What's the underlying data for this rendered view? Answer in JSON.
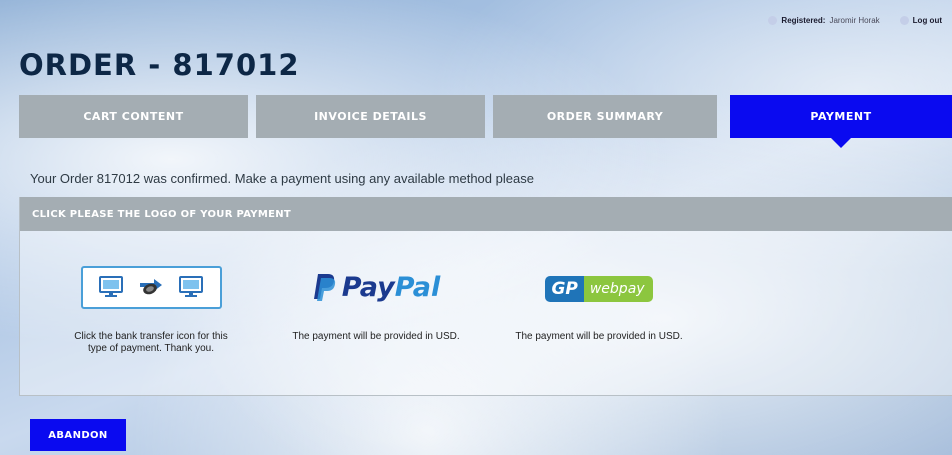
{
  "topbar": {
    "registered_label": "Registered:",
    "registered_name": "Jaromir Horak",
    "logout_label": "Log out"
  },
  "page": {
    "title": "ORDER - 817012"
  },
  "tabs": [
    {
      "label": "CART CONTENT",
      "active": false
    },
    {
      "label": "INVOICE DETAILS",
      "active": false
    },
    {
      "label": "ORDER SUMMARY",
      "active": false
    },
    {
      "label": "PAYMENT",
      "active": true
    }
  ],
  "confirmation": {
    "text": "Your Order 817012 was confirmed.  Make a payment using any available method please"
  },
  "payment_panel": {
    "header": "CLICK PLEASE THE LOGO OF YOUR PAYMENT",
    "methods": [
      {
        "icon": "bank-transfer-icon",
        "description": "Click the bank transfer icon for this type of payment. Thank you."
      },
      {
        "icon": "paypal-logo",
        "logo_text_1": "Pay",
        "logo_text_2": "Pal",
        "description": "The payment will be provided in USD."
      },
      {
        "icon": "gp-webpay-logo",
        "logo_text_1": "GP",
        "logo_text_2": "webpay",
        "description": "The payment will be provided in USD."
      }
    ]
  },
  "actions": {
    "abandon_label": "ABANDON"
  },
  "colors": {
    "accent": "#0a0af0",
    "tab_inactive": "#a4adb3",
    "title": "#0d2746",
    "paypal_dark": "#1b3a8f",
    "paypal_light": "#2b8fd6",
    "gp_blue": "#1f74b8",
    "webpay_green": "#8cc63f"
  }
}
